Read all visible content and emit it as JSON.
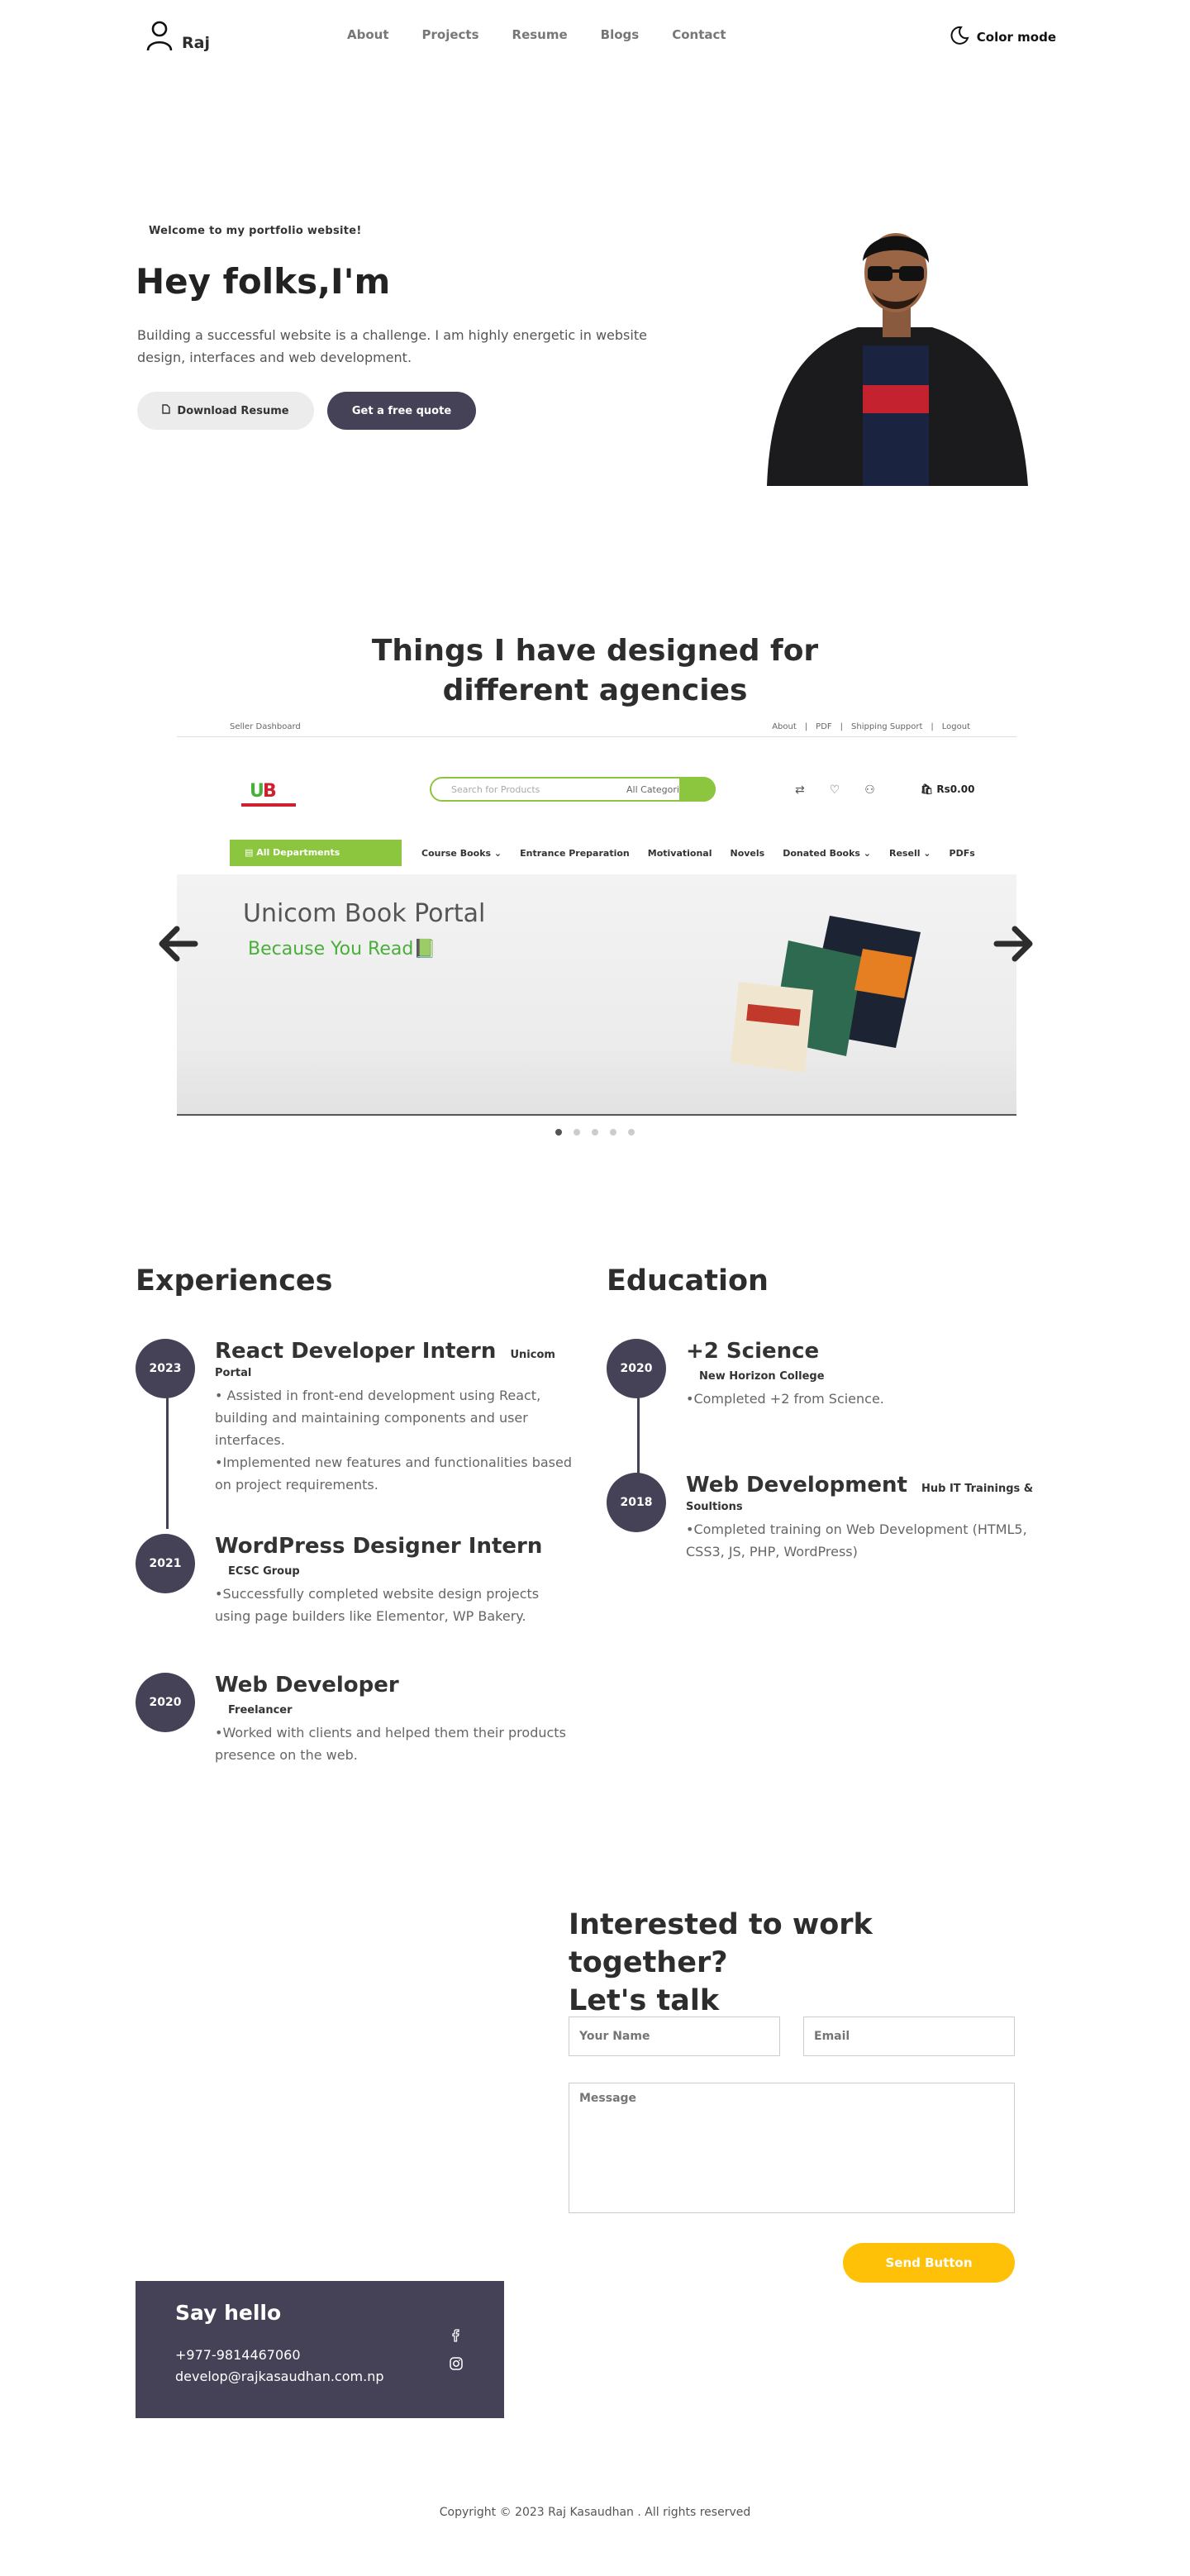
{
  "nav": {
    "brand": "Raj",
    "links": [
      "About",
      "Projects",
      "Resume",
      "Blogs",
      "Contact"
    ],
    "color_mode": "Color mode"
  },
  "hero": {
    "tag": "Welcome to my portfolio website!",
    "title": "Hey folks,I'm",
    "description": "Building a successful website is a challenge. I am highly energetic in website design, interfaces and web development.",
    "resume_button": "Download Resume",
    "quote_button": "Get a free quote"
  },
  "projects": {
    "title": "Things I have designed for different agencies",
    "slide": {
      "top_left": "Seller Dashboard",
      "top_links": [
        "About",
        "PDF",
        "Shipping Support",
        "Logout"
      ],
      "search_placeholder": "Search for Products",
      "category": "All Categories",
      "cart": "Rs0.00",
      "departments": "All Departments",
      "menu": [
        "Course Books ⌄",
        "Entrance Preparation",
        "Motivational",
        "Novels",
        "Donated Books ⌄",
        "Resell ⌄",
        "PDFs"
      ],
      "banner_title": "Unicom Book Portal",
      "banner_subtitle": "Because You Read📗"
    },
    "dots": 5,
    "active_dot": 0
  },
  "experiences": {
    "title": "Experiences",
    "items": [
      {
        "year": "2023",
        "title": "React Developer Intern",
        "org": "Unicom Portal",
        "desc": [
          "• Assisted in front-end development using React, building and maintaining components and user interfaces.",
          "•Implemented new features and functionalities based on project requirements."
        ]
      },
      {
        "year": "2021",
        "title": "WordPress Designer Intern",
        "org": "ECSC Group",
        "desc": [
          "•Successfully completed website design projects using page builders like Elementor, WP Bakery."
        ]
      },
      {
        "year": "2020",
        "title": "Web Developer",
        "org": "Freelancer",
        "desc": [
          "•Worked with clients and helped them their products presence on the web."
        ]
      }
    ]
  },
  "education": {
    "title": "Education",
    "items": [
      {
        "year": "2020",
        "title": "+2 Science",
        "org": "New Horizon College",
        "desc": [
          "•Completed +2 from Science."
        ]
      },
      {
        "year": "2018",
        "title": "Web Development",
        "org": "Hub IT Trainings & Soultions",
        "desc": [
          "•Completed training on Web Development (HTML5, CSS3, JS, PHP, WordPress)"
        ]
      }
    ]
  },
  "contact": {
    "title_line1": "Interested to work together?",
    "title_line2": "Let's talk",
    "name_placeholder": "Your Name",
    "email_placeholder": "Email",
    "message_placeholder": "Message",
    "send_button": "Send Button"
  },
  "say_hello": {
    "title": "Say hello",
    "phone": "+977-9814467060",
    "email": "develop@rajkasaudhan.com.np"
  },
  "footer": "Copyright © 2023 Raj Kasaudhan . All rights reserved"
}
